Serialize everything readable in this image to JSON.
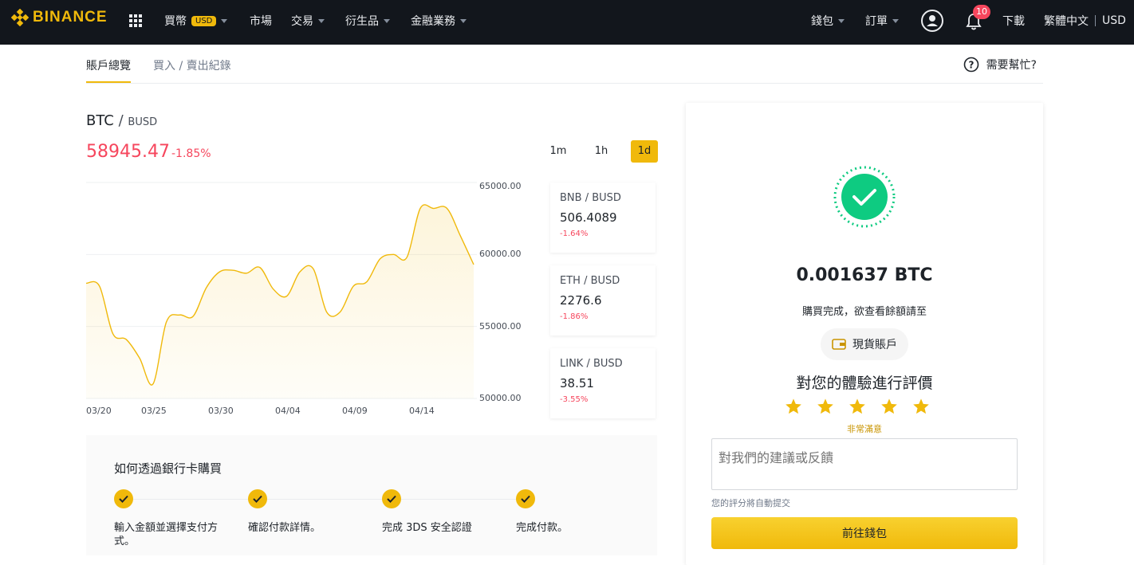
{
  "nav": {
    "logo": "BINANCE",
    "buy": "買幣",
    "currency_tag": "USD",
    "markets": "市場",
    "trade": "交易",
    "derivatives": "衍生品",
    "finance": "金融業務",
    "wallet": "錢包",
    "orders": "訂單",
    "notification_count": "10",
    "download": "下載",
    "language": "繁體中文",
    "currency": "USD"
  },
  "subtabs": {
    "overview": "賬戶總覽",
    "history": "買入 / 賣出紀錄",
    "help": "需要幫忙?"
  },
  "pair": {
    "base": "BTC",
    "slash": "/",
    "quote": "BUSD",
    "price": "58945.47",
    "change": "-1.85%"
  },
  "timeframes": [
    "1m",
    "1h",
    "1d"
  ],
  "active_timeframe": "1d",
  "tickers": [
    {
      "base": "BNB",
      "quote": "/ BUSD",
      "price": "506.4089",
      "change": "-1.64%"
    },
    {
      "base": "ETH",
      "quote": "/ BUSD",
      "price": "2276.6",
      "change": "-1.86%"
    },
    {
      "base": "LINK",
      "quote": "/ BUSD",
      "price": "38.51",
      "change": "-3.55%"
    }
  ],
  "chart_data": {
    "type": "area",
    "y_tick_labels": [
      "65000.00",
      "60000.00",
      "55000.00",
      "50000.00"
    ],
    "x_tick_labels": [
      "03/20",
      "03/25",
      "03/30",
      "04/04",
      "04/09",
      "04/14"
    ],
    "ylim": [
      50000,
      65000
    ],
    "grid": true,
    "line_color": "#f0b90b",
    "series": [
      {
        "x": [
          "03/19",
          "03/20",
          "03/21",
          "03/22",
          "03/23",
          "03/24",
          "03/25",
          "03/26",
          "03/27",
          "03/28",
          "03/29",
          "03/30",
          "03/31",
          "04/01",
          "04/02",
          "04/03",
          "04/04",
          "04/05",
          "04/06",
          "04/07",
          "04/08",
          "04/09",
          "04/10",
          "04/11",
          "04/12",
          "04/13",
          "04/14",
          "04/15",
          "04/16",
          "04/17"
        ],
        "values": [
          58000,
          57800,
          54500,
          54100,
          52800,
          51000,
          55300,
          55800,
          55700,
          57700,
          58800,
          58900,
          58700,
          59100,
          57600,
          57100,
          58800,
          59000,
          56000,
          56000,
          57800,
          58100,
          59700,
          60000,
          59800,
          63200,
          63200,
          63200,
          61300,
          59300
        ]
      }
    ]
  },
  "howto": {
    "title": "如何透過銀行卡購買",
    "steps": [
      "輸入金額並選擇支付方式。",
      "確認付款詳情。",
      "完成 3DS 安全認證",
      "完成付款。"
    ]
  },
  "success": {
    "amount": "0.001637 BTC",
    "message": "購買完成，欲查看餘額請至",
    "spot_account": "現貨賬戶",
    "rating_title": "對您的體驗進行評價",
    "rating": 5,
    "rating_label": "非常滿意",
    "feedback_placeholder": "對我們的建議或反饋",
    "auto_submit_note": "您的評分將自動提交",
    "go_wallet": "前往錢包"
  },
  "colors": {
    "brand": "#f0b90b",
    "down": "#f6465d",
    "success": "#0ecb81",
    "nav_bg": "#12161c"
  }
}
